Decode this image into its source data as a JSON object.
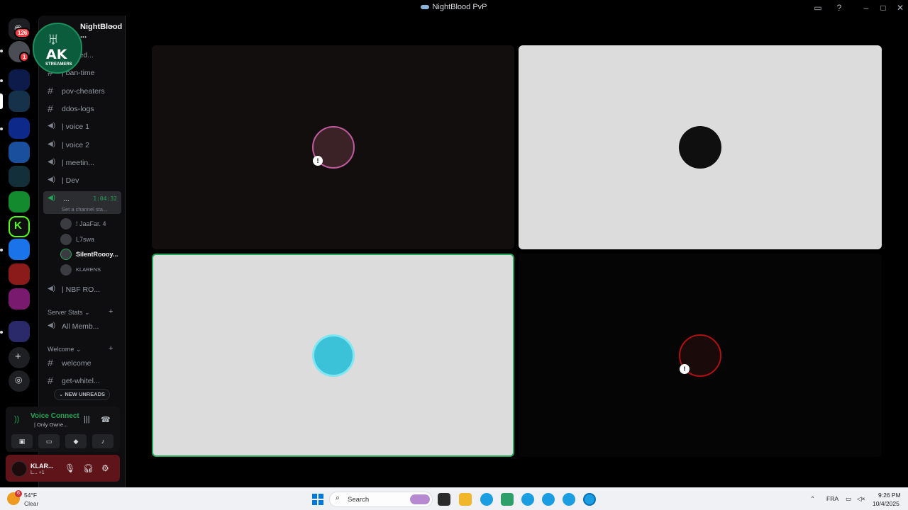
{
  "window": {
    "title": "NightBlood PvP"
  },
  "rail": {
    "home_badge": "126",
    "dm_badge": "1"
  },
  "server": {
    "name": "NightBlood ..."
  },
  "channels": [
    {
      "label": "Banned...",
      "type": "text"
    },
    {
      "label": "| ban-time",
      "type": "text"
    },
    {
      "label": "pov-cheaters",
      "type": "text"
    },
    {
      "label": "ddos-logs",
      "type": "text"
    },
    {
      "label": "| voice 1",
      "type": "voice"
    },
    {
      "label": "| voice 2",
      "type": "voice"
    },
    {
      "label": "| meetin...",
      "type": "voice"
    },
    {
      "label": "| Dev",
      "type": "voice"
    }
  ],
  "active_channel": {
    "label": "...",
    "timer": "1:04:32",
    "status": "Set a channel sta..."
  },
  "members": [
    {
      "name": "! JaaFar. 4"
    },
    {
      "name": "L7swa"
    },
    {
      "name": "SilentRoooy..."
    },
    {
      "name": "KLARENS"
    }
  ],
  "more_channels": {
    "nbf": "| NBF RO..."
  },
  "categories": {
    "server_stats": "Server Stats",
    "all_members": "All Memb...",
    "welcome": "Welcome",
    "welcome_ch": "welcome",
    "whitelist_ch": "get-whitel..."
  },
  "new_unreads": "NEW UNREADS",
  "voice": {
    "title": "Voice Connect",
    "sub": "| Only Owne..."
  },
  "user": {
    "name": "KLAR...",
    "sub": "L... +1"
  },
  "overlay": {
    "logo_text": "AK",
    "logo_sub": "STREAMERS"
  },
  "taskbar": {
    "weather_temp": "54°F",
    "weather_cond": "Clear",
    "weather_badge": "6",
    "search_placeholder": "Search",
    "lang": "FRA",
    "time": "9:26 PM",
    "date": "10/4/2025"
  },
  "colors": {
    "accent": "#23a559",
    "bg": "#000000",
    "tile_light": "#dcdcdc",
    "tile_dark": "#130e0e"
  }
}
